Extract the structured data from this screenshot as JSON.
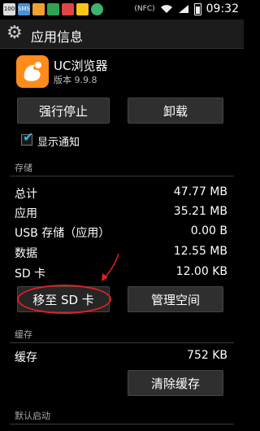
{
  "statusbar": {
    "time": "09:32",
    "left_icons": [
      {
        "name": "battery-100-badge-icon",
        "text": "100",
        "color": "#dddddd"
      },
      {
        "name": "sms-icon",
        "text": "SMS",
        "color": "#4a90d9"
      },
      {
        "name": "app-icon",
        "text": "",
        "color": "#f0a030"
      },
      {
        "name": "app-icon",
        "text": "",
        "color": "#2ea44f"
      },
      {
        "name": "app-icon",
        "text": "",
        "color": "#e04444"
      },
      {
        "name": "app-icon",
        "text": "",
        "color": "#f5c518"
      },
      {
        "name": "app-icon",
        "text": "",
        "color": "#3cb371"
      }
    ],
    "nfc": "(NFC)"
  },
  "actionbar": {
    "title": "应用信息"
  },
  "app": {
    "name": "UC浏览器",
    "version": "版本 9.9.8"
  },
  "buttons": {
    "force_stop": "强行停止",
    "uninstall": "卸载",
    "move_to_sd": "移至 SD 卡",
    "manage_space": "管理空间",
    "clear_cache": "清除缓存"
  },
  "notification": {
    "label": "显示通知",
    "checked": true
  },
  "storage": {
    "header": "存储",
    "rows": [
      {
        "label": "总计",
        "value": "47.77 MB"
      },
      {
        "label": "应用",
        "value": "35.21 MB"
      },
      {
        "label": "USB 存储（应用）",
        "value": "0.00 B"
      },
      {
        "label": "数据",
        "value": "12.55 MB"
      },
      {
        "label": "SD 卡",
        "value": "12.00 KB"
      }
    ]
  },
  "cache": {
    "header": "缓存",
    "label": "缓存",
    "value": "752 KB"
  },
  "launch": {
    "header": "默认启动"
  },
  "colors": {
    "accent": "#33b5e5",
    "annotation": "#e02020",
    "app_icon": "#ff8c1a"
  }
}
